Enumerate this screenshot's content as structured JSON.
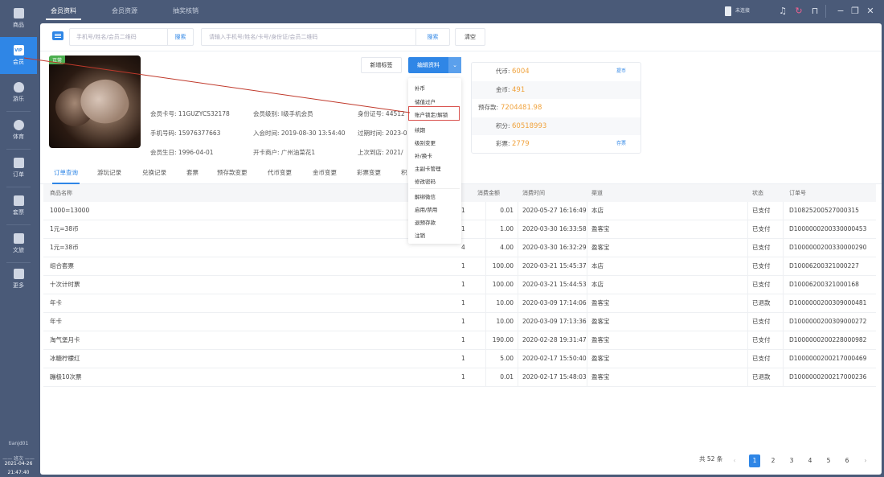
{
  "topbar": {
    "tabs": [
      {
        "label": "会员资料",
        "active": true
      },
      {
        "label": "会员资源",
        "active": false
      },
      {
        "label": "抽奖核销",
        "active": false
      }
    ],
    "device_status": "未连接",
    "icons": [
      "bell-icon",
      "refresh-icon",
      "lock-icon",
      "minimize-icon",
      "restore-icon",
      "close-icon"
    ]
  },
  "sidebar": {
    "items": [
      {
        "label": "商品",
        "icon": "goods-icon",
        "active": false
      },
      {
        "label": "会员",
        "icon": "vip-icon",
        "active": true
      },
      {
        "label": "游乐",
        "icon": "balloon-icon",
        "active": false
      },
      {
        "label": "体育",
        "icon": "ball-icon",
        "active": false
      },
      {
        "label": "订单",
        "icon": "order-icon",
        "active": false
      },
      {
        "label": "套票",
        "icon": "ticket-icon",
        "active": false
      },
      {
        "label": "文旅",
        "icon": "culture-icon",
        "active": false
      },
      {
        "label": "更多",
        "icon": "grid-icon",
        "active": false
      }
    ],
    "user": "tianjd01",
    "shift_label": "—— 班次 ——",
    "date": "2021-04-26",
    "time": "21:47:40"
  },
  "search": {
    "left_placeholder": "手机号/姓名/会员二维码",
    "left_button": "搜索",
    "main_placeholder": "请输入手机号/姓名/卡号/身份证/会员二维码",
    "main_button": "搜索",
    "clear_button": "清空"
  },
  "member": {
    "status_badge": "正常",
    "card_no_label": "会员卡号:",
    "card_no": "11GUZYCS32178",
    "level_label": "会员级别:",
    "level": "I级手机会员",
    "id_label": "身份证号:",
    "id": "44512",
    "phone_label": "手机号码:",
    "phone": "15976377663",
    "join_label": "入会时间:",
    "join_time": "2019-08-30 13:54:40",
    "expire_label": "过期时间:",
    "expire": "2023-0",
    "birthday_label": "会员生日:",
    "birthday": "1996-04-01",
    "merchant_label": "开卡商户:",
    "merchant": "广州油菜花1",
    "last_visit_label": "上次到店:",
    "last_visit": "2021/"
  },
  "actions": {
    "add_tag": "新增标签",
    "edit_profile": "编辑资料",
    "dropdown": [
      "补币",
      "储值过户",
      "账户锁定/解锁",
      "续期",
      "级别变更",
      "补/换卡",
      "主副卡管理",
      "修改密码",
      "解绑微信",
      "启用/禁用",
      "退预存款",
      "注销"
    ],
    "highlighted_item": "账户锁定/解锁"
  },
  "wallet": {
    "rows": [
      {
        "label": "代币:",
        "value": "6004",
        "action": "提币"
      },
      {
        "label": "金币:",
        "value": "491",
        "action": ""
      },
      {
        "label": "预存款:",
        "value": "7204481.98",
        "action": ""
      },
      {
        "label": "积分:",
        "value": "60518993",
        "action": ""
      },
      {
        "label": "彩票:",
        "value": "2779",
        "action": "存票"
      }
    ]
  },
  "record_tabs": [
    {
      "label": "订单查询",
      "active": true
    },
    {
      "label": "游玩记录",
      "active": false
    },
    {
      "label": "兑换记录",
      "active": false
    },
    {
      "label": "套票",
      "active": false
    },
    {
      "label": "预存款变更",
      "active": false
    },
    {
      "label": "代币变更",
      "active": false
    },
    {
      "label": "金币变更",
      "active": false
    },
    {
      "label": "彩票变更",
      "active": false
    },
    {
      "label": "积",
      "active": false
    }
  ],
  "table": {
    "headers": {
      "name": "商品名称",
      "qty": "",
      "amount": "消费金额",
      "time": "消费时间",
      "channel": "渠道",
      "status": "状态",
      "order_no": "订单号"
    },
    "rows": [
      {
        "name": "1000=13000",
        "qty": "1",
        "amount": "0.01",
        "time": "2020-05-27 16:16:49",
        "channel": "本店",
        "status": "已支付",
        "order_no": "D10825200527000315"
      },
      {
        "name": "1元=38币",
        "qty": "1",
        "amount": "1.00",
        "time": "2020-03-30 16:33:58",
        "channel": "盈客宝",
        "status": "已支付",
        "order_no": "D1000000200330000453"
      },
      {
        "name": "1元=38币",
        "qty": "4",
        "amount": "4.00",
        "time": "2020-03-30 16:32:29",
        "channel": "盈客宝",
        "status": "已支付",
        "order_no": "D1000000200330000290"
      },
      {
        "name": "组合套票",
        "qty": "1",
        "amount": "100.00",
        "time": "2020-03-21 15:45:37",
        "channel": "本店",
        "status": "已支付",
        "order_no": "D10006200321000227"
      },
      {
        "name": "十次计时票",
        "qty": "1",
        "amount": "100.00",
        "time": "2020-03-21 15:44:53",
        "channel": "本店",
        "status": "已支付",
        "order_no": "D10006200321000168"
      },
      {
        "name": "年卡",
        "qty": "1",
        "amount": "10.00",
        "time": "2020-03-09 17:14:06",
        "channel": "盈客宝",
        "status": "已退款",
        "order_no": "D1000000200309000481"
      },
      {
        "name": "年卡",
        "qty": "1",
        "amount": "10.00",
        "time": "2020-03-09 17:13:36",
        "channel": "盈客宝",
        "status": "已支付",
        "order_no": "D1000000200309000272"
      },
      {
        "name": "淘气堡月卡",
        "qty": "1",
        "amount": "190.00",
        "time": "2020-02-28 19:31:47",
        "channel": "盈客宝",
        "status": "已支付",
        "order_no": "D1000000200228000982"
      },
      {
        "name": "冰糖柠檬红",
        "qty": "1",
        "amount": "5.00",
        "time": "2020-02-17 15:50:40",
        "channel": "盈客宝",
        "status": "已支付",
        "order_no": "D1000000200217000469"
      },
      {
        "name": "蹦极10次票",
        "qty": "1",
        "amount": "0.01",
        "time": "2020-02-17 15:48:03",
        "channel": "盈客宝",
        "status": "已退款",
        "order_no": "D1000000200217000236"
      }
    ]
  },
  "pagination": {
    "total": "共 52 条",
    "pages": [
      "1",
      "2",
      "3",
      "4",
      "5",
      "6"
    ],
    "current": "1",
    "prev": "‹",
    "next": "›"
  }
}
